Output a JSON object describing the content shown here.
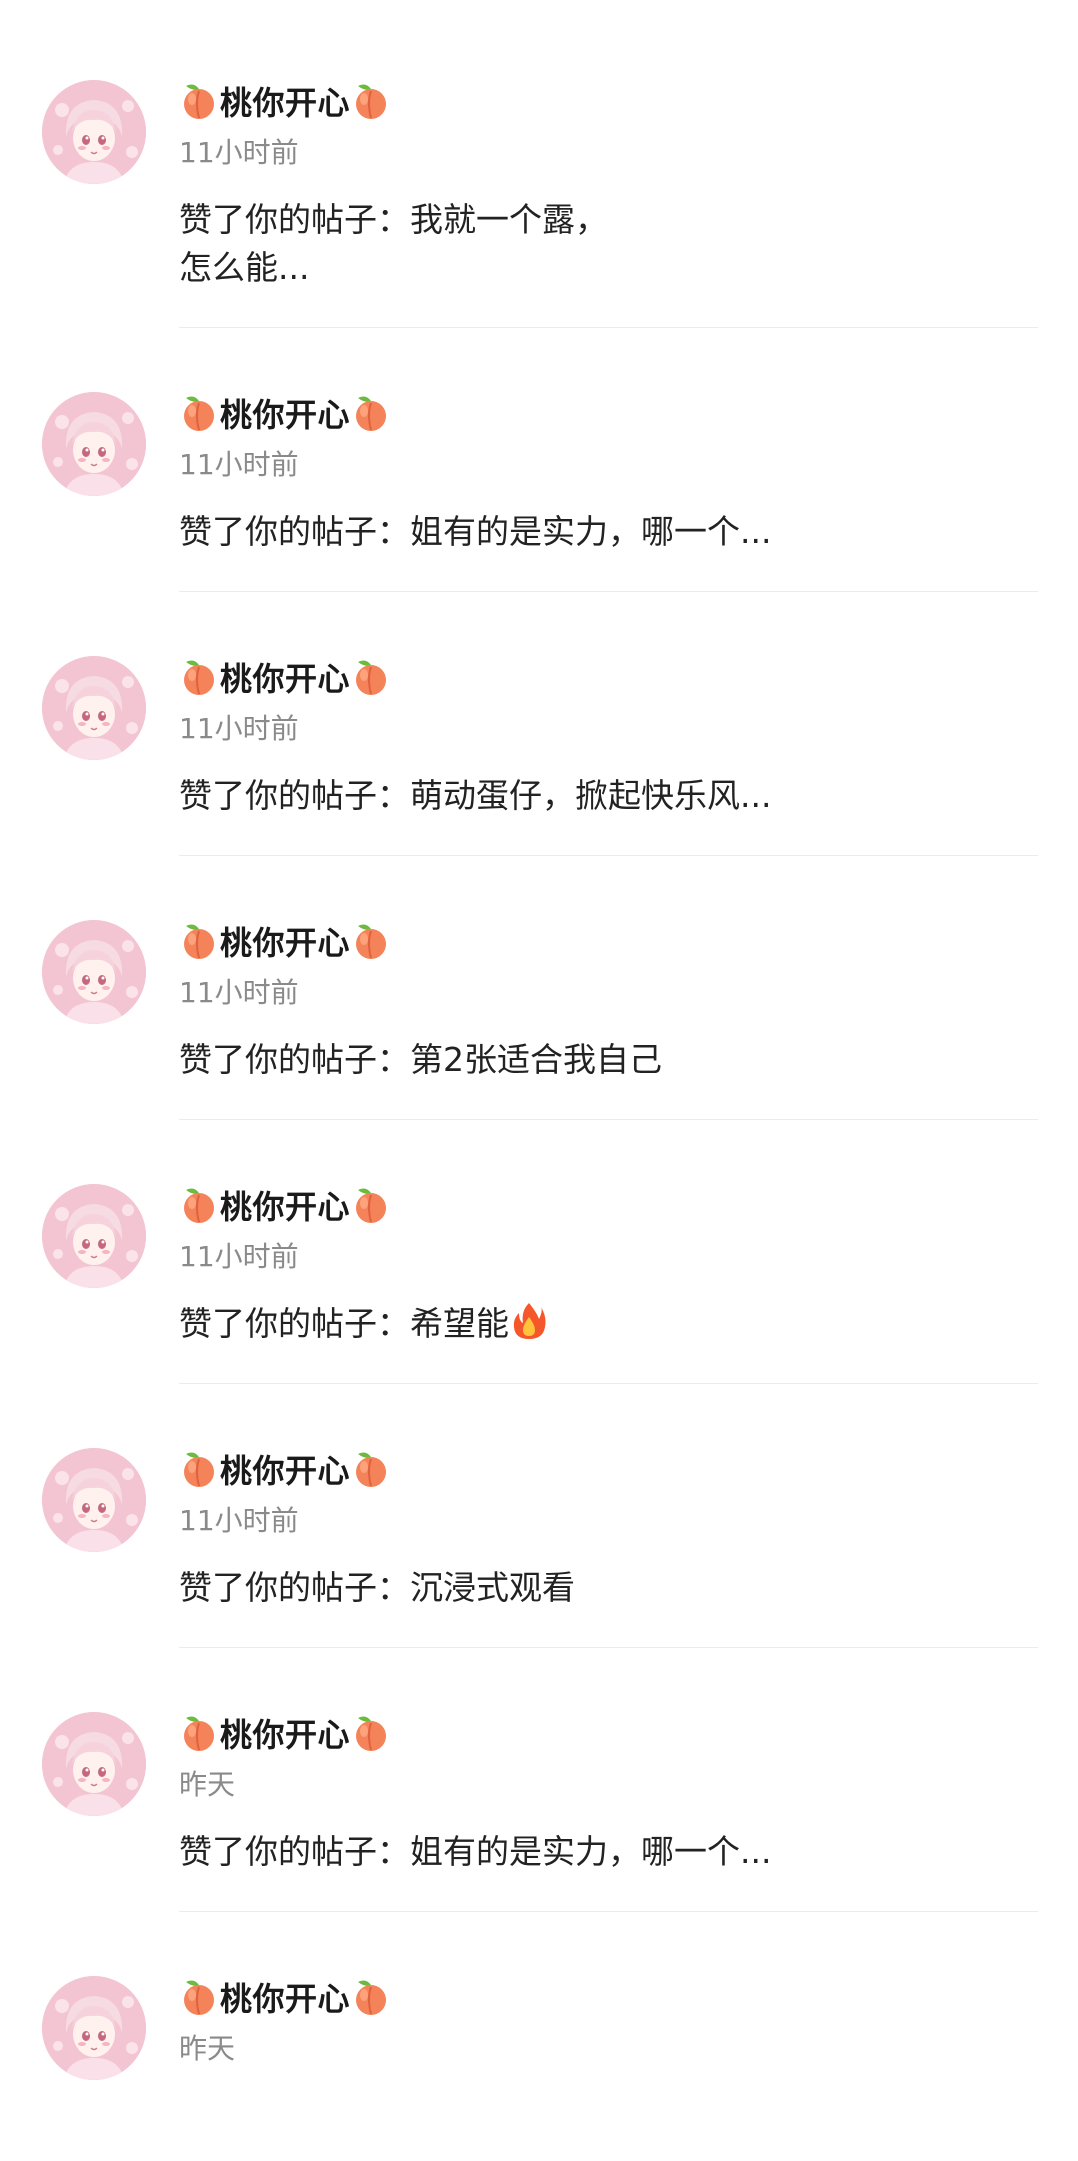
{
  "notifications": [
    {
      "user": "桃你开心",
      "time": "11小时前",
      "message": "赞了你的帖子：我就一个露，",
      "message_line2": "怎么能..."
    },
    {
      "user": "桃你开心",
      "time": "11小时前",
      "message": "赞了你的帖子：姐有的是实力，哪一个..."
    },
    {
      "user": "桃你开心",
      "time": "11小时前",
      "message": "赞了你的帖子：萌动蛋仔，掀起快乐风..."
    },
    {
      "user": "桃你开心",
      "time": "11小时前",
      "message": "赞了你的帖子：第2张适合我自己"
    },
    {
      "user": "桃你开心",
      "time": "11小时前",
      "message": "赞了你的帖子：希望能",
      "emoji": "fire-icon"
    },
    {
      "user": "桃你开心",
      "time": "11小时前",
      "message": "赞了你的帖子：沉浸式观看"
    },
    {
      "user": "桃你开心",
      "time": "昨天",
      "message": "赞了你的帖子：姐有的是实力，哪一个..."
    },
    {
      "user": "桃你开心",
      "time": "昨天",
      "message": ""
    }
  ],
  "icons": {
    "name_prefix": "peach-icon",
    "name_suffix": "peach-icon",
    "avatar": "anime-girl-avatar"
  },
  "colors": {
    "name": "#1a1a1a",
    "time": "#8a8a8a",
    "message": "#222222",
    "divider": "#ececec",
    "peach": "#f4835a",
    "avatar_pink": "#f6c9d6"
  }
}
